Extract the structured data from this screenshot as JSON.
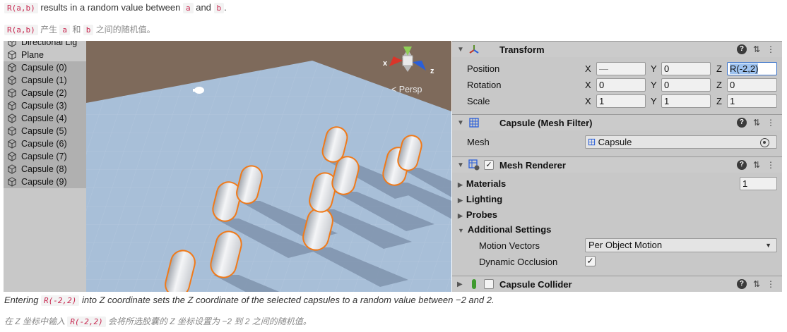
{
  "doc": {
    "line1_code": "R(a,b)",
    "line1_a": " results in a random value between ",
    "line1_code_a": "a",
    "line1_and": " and ",
    "line1_code_b": "b",
    "line1_end": ".",
    "line2_code": "R(a,b)",
    "line2_a": " 产生 ",
    "line2_code_a": "a",
    "line2_and": " 和 ",
    "line2_code_b": "b",
    "line2_end": " 之间的随机值。"
  },
  "caption": {
    "en_pre": "Entering ",
    "en_code": "R(-2,2)",
    "en_post": " into Z coordinate sets the Z coordinate of the selected capsules to a random value between −2 and 2.",
    "cn_pre": "在 Z 坐标中输入 ",
    "cn_code": "R(-2,2)",
    "cn_post": " 会将所选胶囊的 Z 坐标设置为 −2 到 2 之间的随机值。"
  },
  "hierarchy": {
    "items": [
      {
        "label": "Directional Lig",
        "selected": false
      },
      {
        "label": "Plane",
        "selected": false
      },
      {
        "label": "Capsule (0)",
        "selected": true
      },
      {
        "label": "Capsule (1)",
        "selected": true
      },
      {
        "label": "Capsule (2)",
        "selected": true
      },
      {
        "label": "Capsule (3)",
        "selected": true
      },
      {
        "label": "Capsule (4)",
        "selected": true
      },
      {
        "label": "Capsule (5)",
        "selected": true
      },
      {
        "label": "Capsule (6)",
        "selected": true
      },
      {
        "label": "Capsule (7)",
        "selected": true
      },
      {
        "label": "Capsule (8)",
        "selected": true
      },
      {
        "label": "Capsule (9)",
        "selected": true
      }
    ]
  },
  "scene": {
    "projection_label": "< Persp",
    "gizmo": {
      "x": "x",
      "z": "z"
    },
    "colors": {
      "floor": "#a8bfd8",
      "sky": "#7e6a5b",
      "outline": "#f07a1a",
      "shadow": "#7f93ad"
    }
  },
  "inspector": {
    "transform": {
      "title": "Transform",
      "position_label": "Position",
      "rotation_label": "Rotation",
      "scale_label": "Scale",
      "axis_x": "X",
      "axis_y": "Y",
      "axis_z": "Z",
      "position": {
        "x": "—",
        "y": "0",
        "z": "R(-2,2)"
      },
      "rotation": {
        "x": "0",
        "y": "0",
        "z": "0"
      },
      "scale": {
        "x": "1",
        "y": "1",
        "z": "1"
      }
    },
    "mesh_filter": {
      "title": "Capsule (Mesh Filter)",
      "mesh_label": "Mesh",
      "mesh_value": "Capsule"
    },
    "mesh_renderer": {
      "title": "Mesh Renderer",
      "enabled_mark": "✓",
      "materials_label": "Materials",
      "materials_count": "1",
      "lighting_label": "Lighting",
      "probes_label": "Probes",
      "additional_label": "Additional Settings",
      "motion_vectors_label": "Motion Vectors",
      "motion_vectors_value": "Per Object Motion",
      "dynamic_occlusion_label": "Dynamic Occlusion",
      "dynamic_occlusion_mark": "✓"
    },
    "capsule_collider": {
      "title": "Capsule Collider"
    },
    "header_buttons": {
      "help": "?",
      "presets": "⇅",
      "menu": "⋮"
    }
  }
}
